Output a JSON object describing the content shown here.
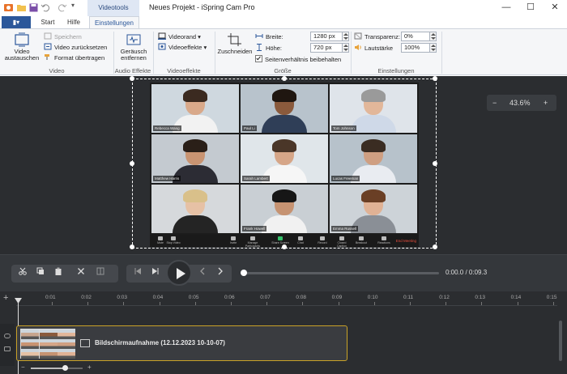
{
  "titlebar": {
    "context_tab": "Videotools",
    "title": "Neues Projekt - iSpring Cam Pro",
    "minimize": "—",
    "maximize": "☐",
    "close": "✕",
    "qa_chevron": "▾"
  },
  "tabs": {
    "file": "▮▾",
    "start": "Start",
    "help": "Hilfe",
    "settings": "Einstellungen"
  },
  "ribbon": {
    "video_group": {
      "label": "Video",
      "replace": "Video austauschen",
      "save": "Speichern",
      "reset": "Video zurücksetzen",
      "copy_format": "Format übertragen"
    },
    "audio_group": {
      "label": "Audio Effekte",
      "remove_noise": "Geräusch entfernen"
    },
    "effects_group": {
      "label": "Videoeffekte",
      "border": "Videorand",
      "effects": "Videoeffekte"
    },
    "size_group": {
      "label": "Größe",
      "crop": "Zuschneiden",
      "width_label": "Breite:",
      "width_value": "1280 px",
      "height_label": "Höhe:",
      "height_value": "720 px",
      "keep_ratio": "Seitenverhältnis beibehalten"
    },
    "settings_group": {
      "label": "Einstellungen",
      "transparency_label": "Transparenz:",
      "transparency_value": "0%",
      "volume_label": "Lautstärke",
      "volume_value": "100%"
    }
  },
  "preview": {
    "zoom_minus": "−",
    "zoom_value": "43.6%",
    "zoom_plus": "+",
    "participants": [
      "Rebecca Wang",
      "Paul Li",
      "Tom Johnson",
      "Matthew Harris",
      "Sarah Lambert",
      "Lucas Freeman",
      "",
      "Frank Howell",
      "Emma Russell"
    ],
    "toolbar": [
      "Mute",
      "Stop Video",
      "Invite",
      "Manage Participants",
      "Share Screen",
      "Chat",
      "Record",
      "Closed Caption",
      "Breakout",
      "Reactions"
    ],
    "end_meeting": "End Meeting"
  },
  "player": {
    "time": "0:00.0 / 0:09.3",
    "progress": 0
  },
  "timeline": {
    "ticks": [
      "0:01",
      "0:02",
      "0:03",
      "0:04",
      "0:05",
      "0:06",
      "0:07",
      "0:08",
      "0:09",
      "0:10",
      "0:11",
      "0:12",
      "0:13",
      "0:14",
      "0:15"
    ],
    "clip_label": "Bildschirmaufnahme (12.12.2023 10-10-07)",
    "add": "+",
    "zoom_minus": "−",
    "zoom_plus": "+"
  },
  "colors": {
    "accent": "#2b579a",
    "clip_border": "#c9a227",
    "dark_bg": "#2b2d30"
  }
}
